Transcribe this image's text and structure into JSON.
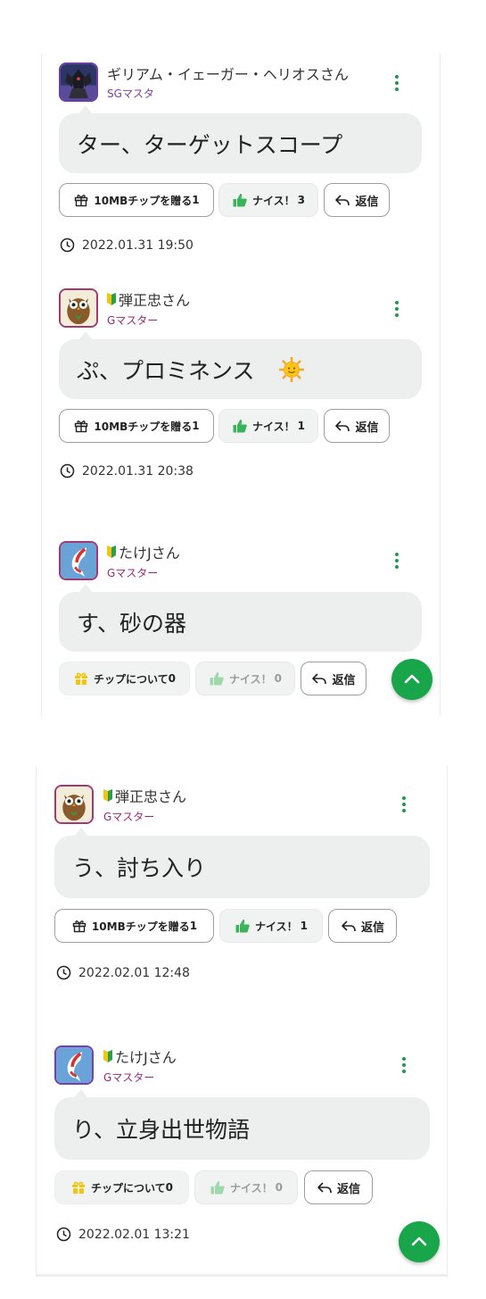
{
  "colors": {
    "accent": "#19a64a",
    "rank": "#9c2a7e",
    "rank_sg": "#7a3fa8",
    "bubble": "#ecefed"
  },
  "posts": [
    {
      "user": "ギリアム・イェーガー・ヘリオスさん",
      "beginner": false,
      "rank": "SGマスタ",
      "message": "ター、ターゲットスコープ",
      "tip_label": "10MBチップを贈る",
      "tip_count": "1",
      "nice_label": "ナイス！",
      "nice_count": "3",
      "reply_label": "返信",
      "time": "2022.01.31 19:50"
    },
    {
      "user": "弾正忠さん",
      "beginner": true,
      "rank": "Gマスター",
      "message": "ぷ、プロミネンス",
      "emoji": "sun-emoji",
      "tip_label": "10MBチップを贈る",
      "tip_count": "1",
      "nice_label": "ナイス！",
      "nice_count": "1",
      "reply_label": "返信",
      "time": "2022.01.31 20:38"
    },
    {
      "user": "たけJさん",
      "beginner": true,
      "rank": "Gマスター",
      "message": "す、砂の器",
      "tip_label": "チップについて",
      "tip_count": "0",
      "nice_label": "ナイス！",
      "nice_count": "0",
      "reply_label": "返信"
    },
    {
      "user": "弾正忠さん",
      "beginner": true,
      "rank": "Gマスター",
      "message": "う、討ち入り",
      "tip_label": "10MBチップを贈る",
      "tip_count": "1",
      "nice_label": "ナイス！",
      "nice_count": "1",
      "reply_label": "返信",
      "time": "2022.02.01 12:48"
    },
    {
      "user": "たけJさん",
      "beginner": true,
      "rank": "Gマスター",
      "message": "り、立身出世物語",
      "tip_label": "チップについて",
      "tip_count": "0",
      "nice_label": "ナイス！",
      "nice_count": "0",
      "reply_label": "返信",
      "time": "2022.02.01 13:21"
    }
  ],
  "icons": {
    "more": "kebab-menu-icon",
    "gift": "gift-icon",
    "thumb": "thumbs-up-icon",
    "reply": "reply-arrow-icon",
    "clock": "clock-icon",
    "scroll_top": "chevron-up-icon",
    "beginner": "beginner-mark-icon"
  }
}
